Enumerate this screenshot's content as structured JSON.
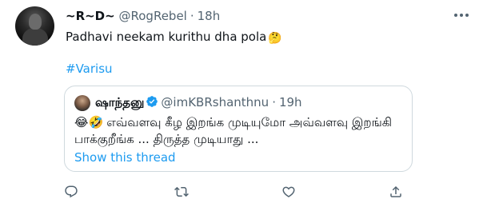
{
  "tweet": {
    "display_name": "~R~D~",
    "handle": "@RogRebel",
    "separator": "·",
    "time": "18h",
    "text": "Padhavi neekam kurithu dha pola",
    "text_emoji": "🤔",
    "hashtag": "#Varisu"
  },
  "quote": {
    "display_name": "ஷாந்தனு",
    "handle": "@imKBRshanthnu",
    "separator": "·",
    "time": "19h",
    "emojis": "😂🤣",
    "line1": "எவ்வளவு கீழ இறங்க முடியுமோ அவ்வளவு இறங்கி",
    "line2": "பாக்குறீங்க ... திருத்த முடியாது ...",
    "show_thread": "Show this thread"
  },
  "icons": {
    "reply": "reply-icon",
    "retweet": "retweet-icon",
    "like": "like-icon",
    "share": "share-icon",
    "more": "more-icon",
    "verified": "verified-badge-icon"
  },
  "colors": {
    "link": "#1d9bf0",
    "secondary_text": "#536471",
    "border": "#cfd9de"
  }
}
